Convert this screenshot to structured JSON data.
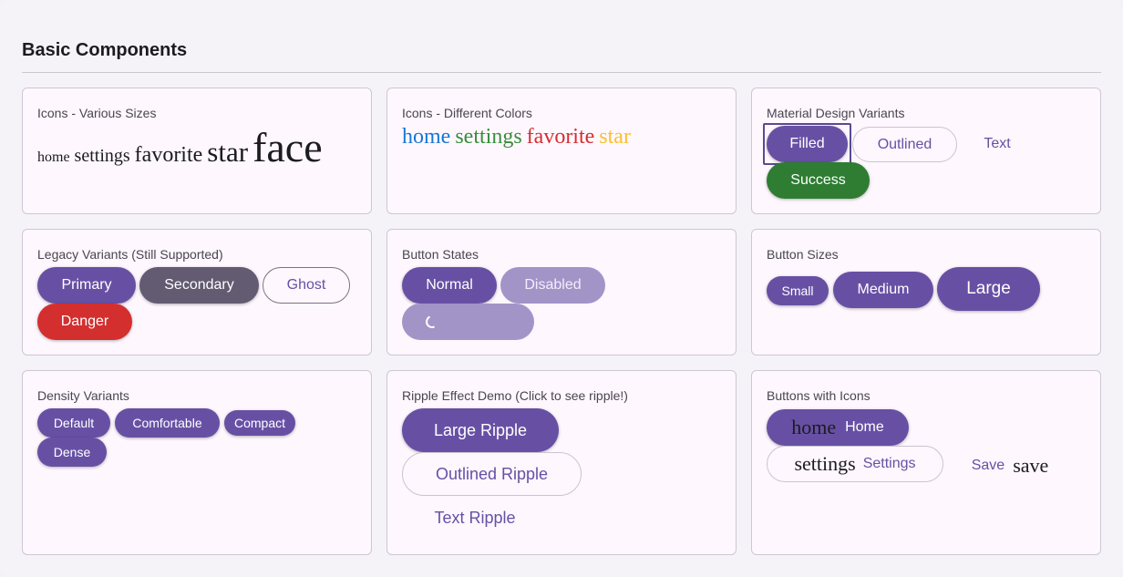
{
  "section": {
    "title": "Basic Components"
  },
  "cards": {
    "icons_sizes": {
      "title": "Icons - Various Sizes",
      "icons": [
        "home",
        "settings",
        "favorite",
        "star",
        "face"
      ]
    },
    "icons_colors": {
      "title": "Icons - Different Colors",
      "icons": [
        {
          "name": "home",
          "color": "#1976d2"
        },
        {
          "name": "settings",
          "color": "#388e3c"
        },
        {
          "name": "favorite",
          "color": "#d32f2f"
        },
        {
          "name": "star",
          "color": "#fbc02d"
        }
      ]
    },
    "md_variants": {
      "title": "Material Design Variants",
      "filled": "Filled",
      "outlined": "Outlined",
      "text": "Text",
      "success": "Success"
    },
    "legacy": {
      "title": "Legacy Variants (Still Supported)",
      "primary": "Primary",
      "secondary": "Secondary",
      "ghost": "Ghost",
      "danger": "Danger"
    },
    "states": {
      "title": "Button States",
      "normal": "Normal",
      "disabled": "Disabled"
    },
    "sizes": {
      "title": "Button Sizes",
      "small": "Small",
      "medium": "Medium",
      "large": "Large"
    },
    "density": {
      "title": "Density Variants",
      "default": "Default",
      "comfortable": "Comfortable",
      "compact": "Compact",
      "dense": "Dense"
    },
    "ripple": {
      "title": "Ripple Effect Demo (Click to see ripple!)",
      "large": "Large Ripple",
      "outlined": "Outlined Ripple",
      "text": "Text Ripple"
    },
    "with_icons": {
      "title": "Buttons with Icons",
      "home_icon": "home",
      "home_label": "Home",
      "settings_icon": "settings",
      "settings_label": "Settings",
      "save_label": "Save",
      "save_icon": "save"
    }
  },
  "colors": {
    "primary": "#6750a4",
    "secondary": "#625b71",
    "success": "#2e7d32",
    "danger": "#d32f2f"
  }
}
